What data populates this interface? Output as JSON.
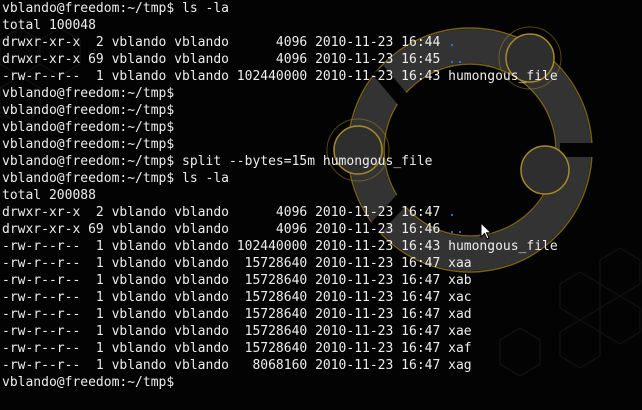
{
  "terminal": {
    "theme": {
      "background": "#030303",
      "text": "#ededed",
      "directory": "#3a7ff0",
      "logo_ring": "#3b3b3b",
      "logo_outline": "#a88a24"
    },
    "lines": [
      {
        "text": "vblando@freedom:~/tmp$ ls -la"
      },
      {
        "text": "total 100048"
      },
      {
        "text": "drwxr-xr-x  2 vblando vblando      4096 2010-11-23 16:44 ",
        "dir": "."
      },
      {
        "text": "drwxr-xr-x 69 vblando vblando      4096 2010-11-23 16:45 ",
        "dir": ".."
      },
      {
        "text": "-rw-r--r--  1 vblando vblando 102440000 2010-11-23 16:43 humongous_file"
      },
      {
        "text": "vblando@freedom:~/tmp$"
      },
      {
        "text": "vblando@freedom:~/tmp$"
      },
      {
        "text": "vblando@freedom:~/tmp$"
      },
      {
        "text": "vblando@freedom:~/tmp$"
      },
      {
        "text": "vblando@freedom:~/tmp$ split --bytes=15m humongous_file"
      },
      {
        "text": "vblando@freedom:~/tmp$ ls -la"
      },
      {
        "text": "total 200088"
      },
      {
        "text": "drwxr-xr-x  2 vblando vblando      4096 2010-11-23 16:47 ",
        "dir": "."
      },
      {
        "text": "drwxr-xr-x 69 vblando vblando      4096 2010-11-23 16:46 ",
        "dir": ".."
      },
      {
        "text": "-rw-r--r--  1 vblando vblando 102440000 2010-11-23 16:43 humongous_file"
      },
      {
        "text": "-rw-r--r--  1 vblando vblando  15728640 2010-11-23 16:47 xaa"
      },
      {
        "text": "-rw-r--r--  1 vblando vblando  15728640 2010-11-23 16:47 xab"
      },
      {
        "text": "-rw-r--r--  1 vblando vblando  15728640 2010-11-23 16:47 xac"
      },
      {
        "text": "-rw-r--r--  1 vblando vblando  15728640 2010-11-23 16:47 xad"
      },
      {
        "text": "-rw-r--r--  1 vblando vblando  15728640 2010-11-23 16:47 xae"
      },
      {
        "text": "-rw-r--r--  1 vblando vblando  15728640 2010-11-23 16:47 xaf"
      },
      {
        "text": "-rw-r--r--  1 vblando vblando   8068160 2010-11-23 16:47 xag"
      },
      {
        "text": "vblando@freedom:~/tmp$"
      }
    ]
  },
  "icons": {
    "background": "ubuntu-logo-icon",
    "pointer": "mouse-pointer-icon"
  }
}
